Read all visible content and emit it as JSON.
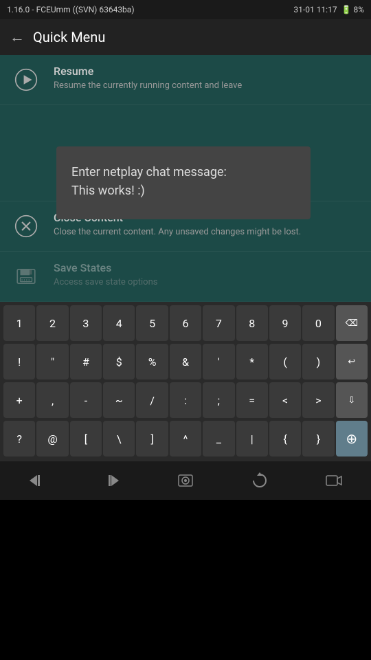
{
  "statusBar": {
    "left": "1.16.0 - FCEUmm ((SVN) 63643ba)",
    "right": "31-01 11:17",
    "battery": "8%"
  },
  "topBar": {
    "title": "Quick Menu",
    "backIcon": "←"
  },
  "menuItems": [
    {
      "id": "resume",
      "label": "Resume",
      "desc": "Resume the currently running content and leave",
      "iconType": "play"
    },
    {
      "id": "chat",
      "label": "",
      "desc": "",
      "iconType": "none",
      "isDialogRow": true
    },
    {
      "id": "close-content",
      "label": "Close Content",
      "desc": "Close the current content. Any unsaved changes might be lost.",
      "iconType": "close",
      "dimmed": false
    },
    {
      "id": "save-states",
      "label": "Save States",
      "desc": "Access save state options",
      "iconType": "save",
      "dimmed": true
    }
  ],
  "chatDialog": {
    "text": "Enter netplay chat message:\nThis works!  :)"
  },
  "keyboard": {
    "rows": [
      [
        "1",
        "2",
        "3",
        "4",
        "5",
        "6",
        "7",
        "8",
        "9",
        "0",
        "⌫"
      ],
      [
        "!",
        "\"",
        "#",
        "$",
        "%",
        "&",
        "'",
        "*",
        "(",
        ")",
        "⏎"
      ],
      [
        "+",
        ",",
        "-",
        "~",
        "/",
        ":",
        ";",
        "=",
        "<",
        ">",
        "↓"
      ],
      [
        "?",
        "@",
        "[",
        "\\",
        "]",
        "^",
        "_",
        "|",
        "{",
        "}",
        "⊕"
      ]
    ]
  },
  "bottomBar": {
    "buttons": [
      "rewind",
      "fast-forward",
      "screenshot",
      "rotation",
      "video"
    ]
  }
}
